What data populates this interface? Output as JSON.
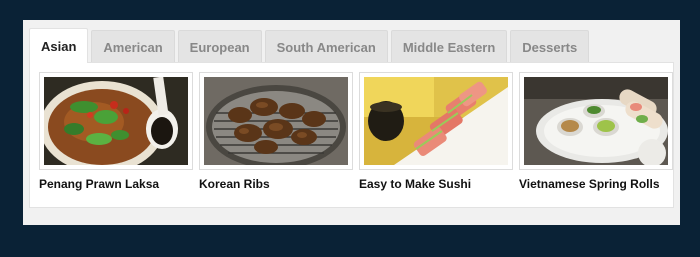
{
  "tabs": [
    {
      "label": "Asian",
      "active": true
    },
    {
      "label": "American",
      "active": false
    },
    {
      "label": "European",
      "active": false
    },
    {
      "label": "South American",
      "active": false
    },
    {
      "label": "Middle Eastern",
      "active": false
    },
    {
      "label": "Desserts",
      "active": false
    }
  ],
  "recipes": [
    {
      "title": "Penang Prawn Laksa",
      "image": "laksa-bowl-photo"
    },
    {
      "title": "Korean Ribs",
      "image": "grilled-ribs-photo"
    },
    {
      "title": "Easy to Make Sushi",
      "image": "sushi-rolls-photo"
    },
    {
      "title": "Vietnamese Spring Rolls",
      "image": "spring-rolls-photo"
    }
  ],
  "colors": {
    "page_background": "#0a2236",
    "widget_background": "#f1f1f1",
    "active_tab": "#ffffff",
    "inactive_tab": "#e4e4e4"
  }
}
